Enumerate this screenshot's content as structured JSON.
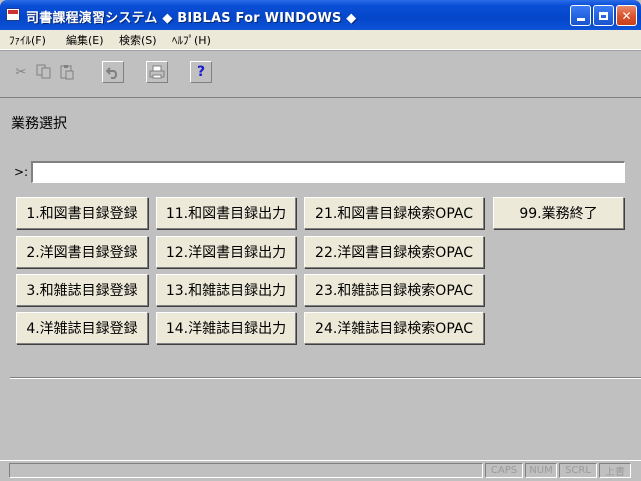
{
  "window": {
    "title": "司書課程演習システム ◆ BIBLAS For WINDOWS ◆"
  },
  "menu": {
    "items": [
      "ﾌｧｲﾙ(F)",
      "編集(E)",
      "検索(S)",
      "ﾍﾙﾌﾟ(H)"
    ]
  },
  "toolbar": {
    "cut_icon": "scissors-icon",
    "copy_icon": "copy-icon",
    "paste_icon": "paste-icon",
    "undo_icon": "undo-icon",
    "print_icon": "printer-icon",
    "help_icon": "help-icon",
    "help_glyph": "?"
  },
  "main": {
    "section_title": "業務選択",
    "prompt": ">:",
    "command_value": "",
    "buttons": {
      "b1": "1.和図書目録登録",
      "b2": "2.洋図書目録登録",
      "b3": "3.和雑誌目録登録",
      "b4": "4.洋雑誌目録登録",
      "b11": "11.和図書目録出力",
      "b12": "12.洋図書目録出力",
      "b13": "13.和雑誌目録出力",
      "b14": "14.洋雑誌目録出力",
      "b21": "21.和図書目録検索OPAC",
      "b22": "22.洋図書目録検索OPAC",
      "b23": "23.和雑誌目録検索OPAC",
      "b24": "24.洋雑誌目録検索OPAC",
      "b99": "99.業務終了"
    }
  },
  "statusbar": {
    "message": "",
    "caps": "CAPS",
    "num": "NUM",
    "scrl": "SCRL",
    "mode": "上書"
  },
  "colors": {
    "titlebar": "#0a4fd6",
    "window_bg": "#c0c0c0",
    "button_bg": "#ece9d8",
    "menubar_bg": "#ece9d8"
  }
}
